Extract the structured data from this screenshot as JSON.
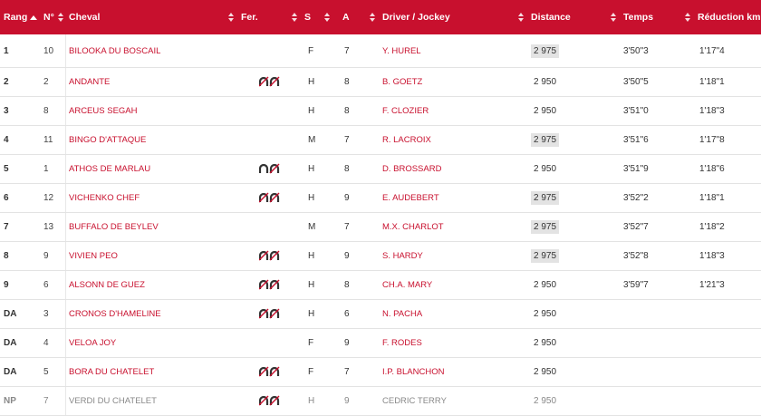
{
  "columns": {
    "rang": "Rang",
    "num": "N°",
    "cheval": "Cheval",
    "fer": "Fer.",
    "sexe": "S",
    "age": "A",
    "driver": "Driver / Jockey",
    "distance": "Distance",
    "temps": "Temps",
    "reduction": "Réduction km"
  },
  "colors": {
    "header_bg": "#c8102e",
    "link": "#c8102e",
    "highlight": "#e3e3e3",
    "muted": "#888888"
  },
  "rows": [
    {
      "rang": "1",
      "num": "10",
      "cheval": "BILOOKA DU BOSCAIL",
      "fer": "none",
      "sexe": "F",
      "age": "7",
      "driver": "Y. HUREL",
      "distance": "2 975",
      "distance_highlight": true,
      "temps": "3'50\"3",
      "reduction": "1'17\"4",
      "muted": false
    },
    {
      "rang": "2",
      "num": "2",
      "cheval": "ANDANTE",
      "fer": "deferre-4",
      "sexe": "H",
      "age": "8",
      "driver": "B. GOETZ",
      "distance": "2 950",
      "distance_highlight": false,
      "temps": "3'50\"5",
      "reduction": "1'18\"1",
      "muted": false
    },
    {
      "rang": "3",
      "num": "8",
      "cheval": "ARCEUS SEGAH",
      "fer": "none",
      "sexe": "H",
      "age": "8",
      "driver": "F. CLOZIER",
      "distance": "2 950",
      "distance_highlight": false,
      "temps": "3'51\"0",
      "reduction": "1'18\"3",
      "muted": false
    },
    {
      "rang": "4",
      "num": "11",
      "cheval": "BINGO D'ATTAQUE",
      "fer": "none",
      "sexe": "M",
      "age": "7",
      "driver": "R. LACROIX",
      "distance": "2 975",
      "distance_highlight": true,
      "temps": "3'51\"6",
      "reduction": "1'17\"8",
      "muted": false
    },
    {
      "rang": "5",
      "num": "1",
      "cheval": "ATHOS DE MARLAU",
      "fer": "deferre-post",
      "sexe": "H",
      "age": "8",
      "driver": "D. BROSSARD",
      "distance": "2 950",
      "distance_highlight": false,
      "temps": "3'51\"9",
      "reduction": "1'18\"6",
      "muted": false
    },
    {
      "rang": "6",
      "num": "12",
      "cheval": "VICHENKO CHEF",
      "fer": "deferre-4",
      "sexe": "H",
      "age": "9",
      "driver": "E. AUDEBERT",
      "distance": "2 975",
      "distance_highlight": true,
      "temps": "3'52\"2",
      "reduction": "1'18\"1",
      "muted": false
    },
    {
      "rang": "7",
      "num": "13",
      "cheval": "BUFFALO DE BEYLEV",
      "fer": "none",
      "sexe": "M",
      "age": "7",
      "driver": "M.X. CHARLOT",
      "distance": "2 975",
      "distance_highlight": true,
      "temps": "3'52\"7",
      "reduction": "1'18\"2",
      "muted": false
    },
    {
      "rang": "8",
      "num": "9",
      "cheval": "VIVIEN PEO",
      "fer": "deferre-4",
      "sexe": "H",
      "age": "9",
      "driver": "S. HARDY",
      "distance": "2 975",
      "distance_highlight": true,
      "temps": "3'52\"8",
      "reduction": "1'18\"3",
      "muted": false
    },
    {
      "rang": "9",
      "num": "6",
      "cheval": "ALSONN DE GUEZ",
      "fer": "deferre-4",
      "sexe": "H",
      "age": "8",
      "driver": "CH.A. MARY",
      "distance": "2 950",
      "distance_highlight": false,
      "temps": "3'59\"7",
      "reduction": "1'21\"3",
      "muted": false
    },
    {
      "rang": "DA",
      "num": "3",
      "cheval": "CRONOS D'HAMELINE",
      "fer": "deferre-4",
      "sexe": "H",
      "age": "6",
      "driver": "N. PACHA",
      "distance": "2 950",
      "distance_highlight": false,
      "temps": "",
      "reduction": "",
      "muted": false
    },
    {
      "rang": "DA",
      "num": "4",
      "cheval": "VELOA JOY",
      "fer": "none",
      "sexe": "F",
      "age": "9",
      "driver": "F. RODES",
      "distance": "2 950",
      "distance_highlight": false,
      "temps": "",
      "reduction": "",
      "muted": false
    },
    {
      "rang": "DA",
      "num": "5",
      "cheval": "BORA DU CHATELET",
      "fer": "deferre-4",
      "sexe": "F",
      "age": "7",
      "driver": "I.P. BLANCHON",
      "distance": "2 950",
      "distance_highlight": false,
      "temps": "",
      "reduction": "",
      "muted": false
    },
    {
      "rang": "NP",
      "num": "7",
      "cheval": "VERDI DU CHATELET",
      "fer": "deferre-4",
      "sexe": "H",
      "age": "9",
      "driver": "CEDRIC TERRY",
      "distance": "2 950",
      "distance_highlight": false,
      "temps": "",
      "reduction": "",
      "muted": true
    }
  ]
}
